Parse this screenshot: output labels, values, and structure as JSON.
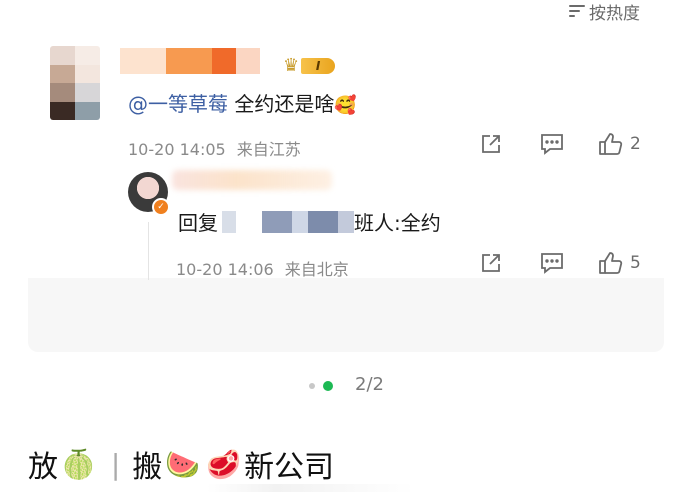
{
  "sort": {
    "label": "按热度",
    "icon": "sort-lines-icon"
  },
  "comment": {
    "badge_level": "I",
    "mention": "@一等草莓",
    "text": " 全约还是啥",
    "emoji": "🥰",
    "time": "10-20 14:05",
    "location": "来自江苏",
    "likes": "2"
  },
  "reply": {
    "prefix": "回复",
    "suffix": "班人:全约",
    "time": "10-20 14:06",
    "location": "来自北京",
    "likes": "5"
  },
  "pager": {
    "label": "2/2"
  },
  "footer": {
    "word1": "放",
    "emoji1": "🍈",
    "separator": "|",
    "word2": "搬",
    "emoji2": "🍉",
    "emoji3": "🥩",
    "word3": "新公司"
  },
  "colors": {
    "mention": "#3d5fa3",
    "pager_active": "#1db954",
    "pager_inactive": "#c8c8c8"
  }
}
